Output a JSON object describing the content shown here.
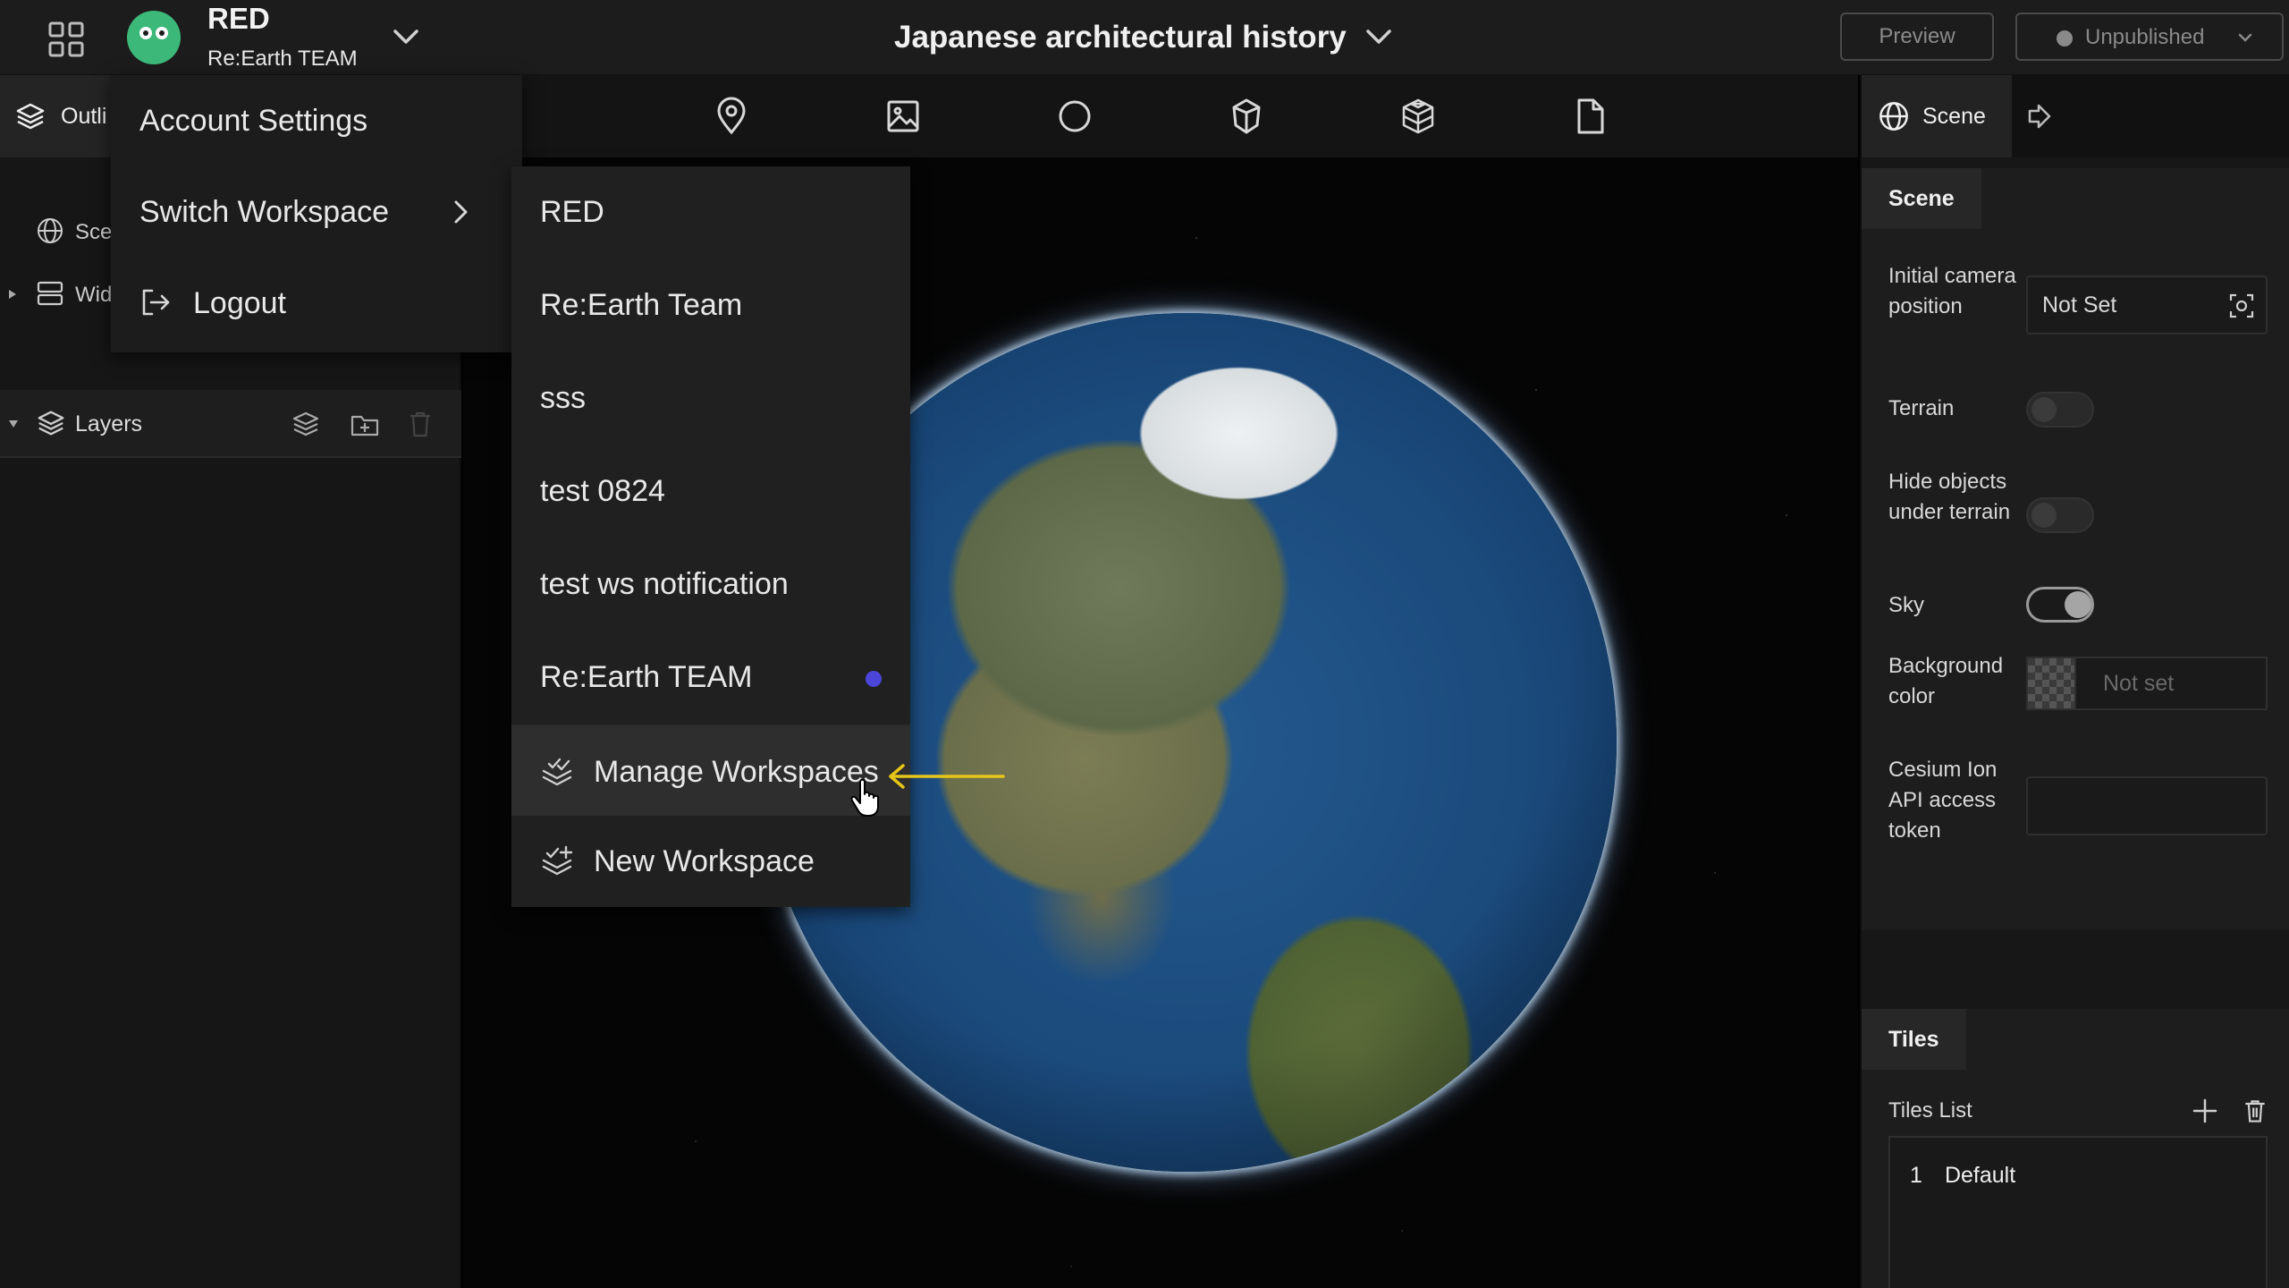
{
  "header": {
    "user_name": "RED",
    "user_team": "Re:Earth TEAM",
    "project_title": "Japanese architectural history",
    "preview_label": "Preview",
    "publish_status": "Unpublished"
  },
  "left_panel": {
    "tab_outline_label": "Outli",
    "scene_label": "Sce",
    "widgets_label": "Wid",
    "layers_label": "Layers"
  },
  "user_menu": {
    "account_settings": "Account Settings",
    "switch_workspace": "Switch Workspace",
    "logout": "Logout"
  },
  "workspace_menu": {
    "workspaces": [
      {
        "label": "RED"
      },
      {
        "label": "Re:Earth Team"
      },
      {
        "label": "sss"
      },
      {
        "label": "test 0824"
      },
      {
        "label": "test ws notification"
      },
      {
        "label": "Re:Earth TEAM",
        "current": true
      }
    ],
    "manage_label": "Manage Workspaces",
    "new_label": "New Workspace"
  },
  "right_panel": {
    "tab_scene_label": "Scene",
    "scene_section": {
      "title": "Scene",
      "initial_camera_label": "Initial camera position",
      "initial_camera_value": "Not Set",
      "terrain_label": "Terrain",
      "terrain_on": false,
      "hide_objects_label": "Hide objects under terrain",
      "hide_objects_on": false,
      "sky_label": "Sky",
      "sky_on": true,
      "bg_color_label": "Background color",
      "bg_color_placeholder": "Not set",
      "cesium_label": "Cesium Ion API access token",
      "cesium_value": ""
    },
    "tiles_section": {
      "title": "Tiles",
      "list_label": "Tiles List",
      "items": [
        {
          "index": "1",
          "name": "Default"
        }
      ]
    }
  },
  "colors": {
    "current_workspace_dot": "#4b45d8",
    "annotation_arrow": "#e6c619",
    "avatar": "#3cb878"
  }
}
